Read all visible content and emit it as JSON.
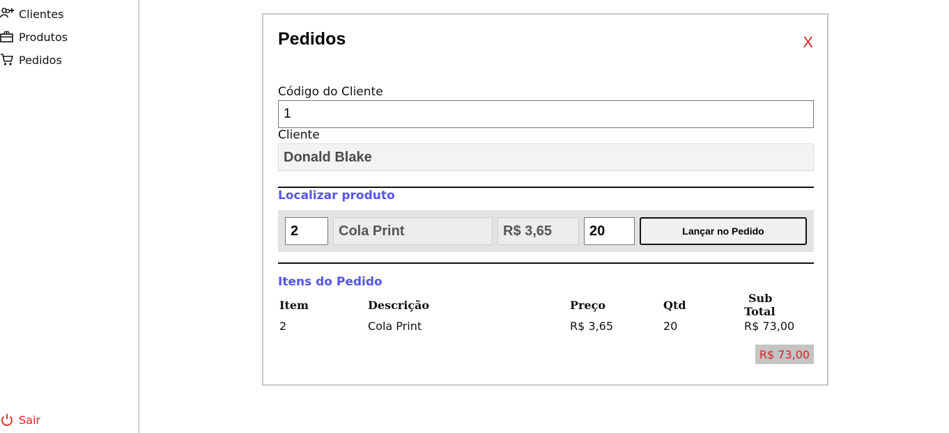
{
  "sidebar": {
    "items": [
      {
        "label": "Clientes",
        "icon": "users-add-icon"
      },
      {
        "label": "Produtos",
        "icon": "box-icon"
      },
      {
        "label": "Pedidos",
        "icon": "cart-icon"
      }
    ],
    "logout": {
      "label": "Sair",
      "icon": "power-icon"
    }
  },
  "modal": {
    "title": "Pedidos",
    "close_label": "X",
    "client_code_label": "Código do Cliente",
    "client_code_value": "1",
    "client_label": "Cliente",
    "client_value": "Donald Blake",
    "search_title": "Localizar produto",
    "product": {
      "code": "2",
      "name": "Cola Print",
      "price": "R$ 3,65",
      "quantity": "20",
      "add_button": "Lançar no Pedido"
    },
    "items_title": "Itens do Pedido",
    "table": {
      "headers": {
        "item": "Item",
        "description": "Descrição",
        "price": "Preço",
        "qty": "Qtd",
        "subtotal_1": "Sub",
        "subtotal_2": "Total"
      },
      "rows": [
        {
          "item": "2",
          "description": "Cola Print",
          "price": "R$ 3,65",
          "qty": "20",
          "subtotal": "R$ 73,00"
        }
      ]
    },
    "total": "R$ 73,00"
  },
  "colors": {
    "accent": "#5555e6",
    "danger": "#e02020"
  }
}
